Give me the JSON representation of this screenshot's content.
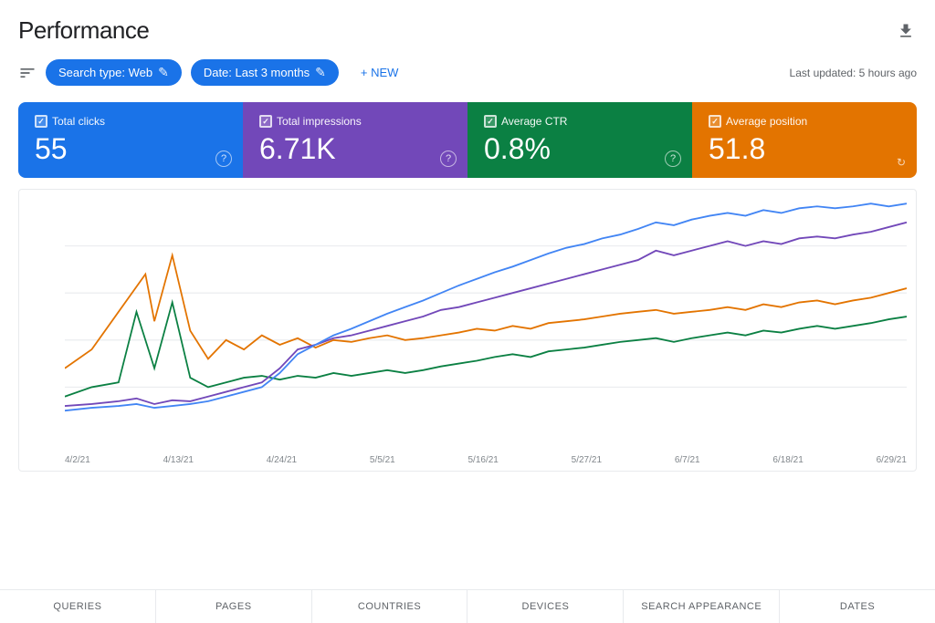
{
  "header": {
    "title": "Performance",
    "last_updated": "Last updated: 5 hours ago"
  },
  "toolbar": {
    "filter_icon": "≡",
    "search_type_chip": "Search type: Web",
    "date_chip": "Date: Last 3 months",
    "new_button": "+ NEW",
    "edit_icon": "✎"
  },
  "metrics": [
    {
      "id": "total-clicks",
      "label": "Total clicks",
      "value": "55",
      "color": "blue",
      "checked": true
    },
    {
      "id": "total-impressions",
      "label": "Total impressions",
      "value": "6.71K",
      "color": "purple",
      "checked": true
    },
    {
      "id": "average-ctr",
      "label": "Average CTR",
      "value": "0.8%",
      "color": "teal",
      "checked": true
    },
    {
      "id": "average-position",
      "label": "Average position",
      "value": "51.8",
      "color": "orange",
      "checked": true
    }
  ],
  "chart": {
    "x_labels": [
      "4/2/21",
      "4/13/21",
      "4/24/21",
      "5/5/21",
      "5/16/21",
      "5/27/21",
      "6/7/21",
      "6/18/21",
      "6/29/21"
    ],
    "series": {
      "clicks_color": "#e37400",
      "impressions_color": "#7248b9",
      "ctr_color": "#0b8043",
      "position_color": "#4285f4"
    }
  },
  "bottom_tabs": [
    {
      "label": "QUERIES",
      "active": false
    },
    {
      "label": "PAGES",
      "active": false
    },
    {
      "label": "COUNTRIES",
      "active": false
    },
    {
      "label": "DEVICES",
      "active": false
    },
    {
      "label": "SEARCH APPEARANCE",
      "active": false
    },
    {
      "label": "DATES",
      "active": false
    }
  ]
}
